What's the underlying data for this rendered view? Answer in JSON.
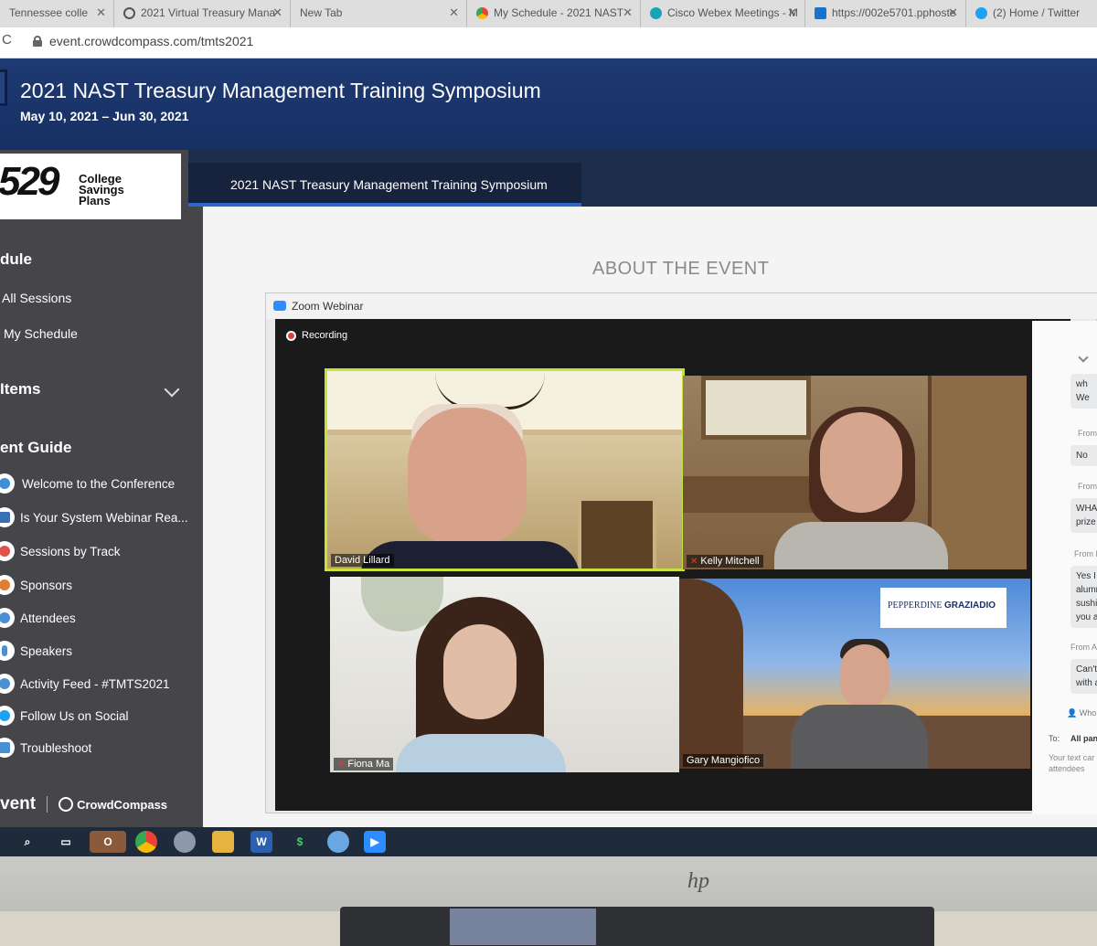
{
  "browser": {
    "tabs": [
      {
        "title": "Tennessee colle",
        "icon": "page-icon",
        "color": "#888888"
      },
      {
        "title": "2021 Virtual Treasury Mana",
        "icon": "globe-icon",
        "color": "#666666"
      },
      {
        "title": "New Tab",
        "icon": "",
        "color": ""
      },
      {
        "title": "My Schedule - 2021 NAST",
        "icon": "chrome-icon",
        "color": "#34a853"
      },
      {
        "title": "Cisco Webex Meetings - M",
        "icon": "webex-icon",
        "color": "#1aa3b8"
      },
      {
        "title": "https://002e5701.pphoste",
        "icon": "app-icon",
        "color": "#1a73c8"
      },
      {
        "title": "(2) Home / Twitter",
        "icon": "twitter-icon",
        "color": "#1da1f2"
      }
    ],
    "url": "event.crowdcompass.com/tmts2021"
  },
  "event": {
    "title": "2021 NAST Treasury Management Training Symposium",
    "dates": "May 10, 2021 – Jun 30, 2021"
  },
  "sidebar": {
    "brand": {
      "number": "529",
      "line1": "College",
      "line2": "Savings",
      "line3": "Plans"
    },
    "schedule_heading": "dule",
    "all_sessions": "All Sessions",
    "my_schedule": "My Schedule",
    "items_heading": "Items",
    "guide_heading": "ent Guide",
    "guide_items": [
      {
        "label": "Welcome to the Conference",
        "icon": "welcome-icon",
        "color": "#3f8fd6"
      },
      {
        "label": "Is Your System Webinar Rea...",
        "icon": "triangle-icon",
        "color": "#3a6fb8"
      },
      {
        "label": "Sessions by Track",
        "icon": "sessions-icon",
        "color": "#e0524a"
      },
      {
        "label": "Sponsors",
        "icon": "sponsors-icon",
        "color": "#e07d2e"
      },
      {
        "label": "Attendees",
        "icon": "attendees-icon",
        "color": "#4a8fd4"
      },
      {
        "label": "Speakers",
        "icon": "mic-icon",
        "color": "#4a8fd4"
      },
      {
        "label": "Activity Feed - #TMTS2021",
        "icon": "feed-icon",
        "color": "#4a8fd4"
      },
      {
        "label": "Follow Us on Social",
        "icon": "twitter-icon",
        "color": "#1da1f2"
      },
      {
        "label": "Troubleshoot",
        "icon": "warning-icon",
        "color": "#4a8fd4"
      }
    ],
    "footer_event": "vent",
    "footer_brand": "CrowdCompass"
  },
  "content": {
    "tab_label": "2021 NAST Treasury Management Training Symposium",
    "about_heading": "ABOUT THE EVENT"
  },
  "zoom": {
    "window_title": "Zoom Webinar",
    "recording_label": "Recording",
    "participants": [
      {
        "name": "David Lillard",
        "muted": false
      },
      {
        "name": "Kelly Mitchell",
        "muted": true
      },
      {
        "name": "Fiona Ma",
        "muted": true
      },
      {
        "name": "Gary Mangiofico",
        "muted": false
      }
    ],
    "backdrop_logo_main": "PEPPERDINE",
    "backdrop_logo_sub": "GRAZIADIO",
    "chat": {
      "messages": [
        {
          "from": "",
          "lines": [
            "wh",
            "We"
          ]
        },
        {
          "from": "From",
          "lines": [
            "No"
          ]
        },
        {
          "from": "From",
          "lines": [
            "WHA",
            "prize"
          ]
        },
        {
          "from": "From Fi",
          "lines": [
            "Yes I a",
            "alumn",
            "sushi a",
            "you all"
          ]
        },
        {
          "from": "From And",
          "lines": [
            "Can't w",
            "with all"
          ]
        }
      ],
      "who_label": "Who",
      "to_label": "To:",
      "to_value": "All pan",
      "input_placeholder_1": "Your text car",
      "input_placeholder_2": "attendees"
    }
  },
  "monitor": {
    "brand": "hp"
  }
}
